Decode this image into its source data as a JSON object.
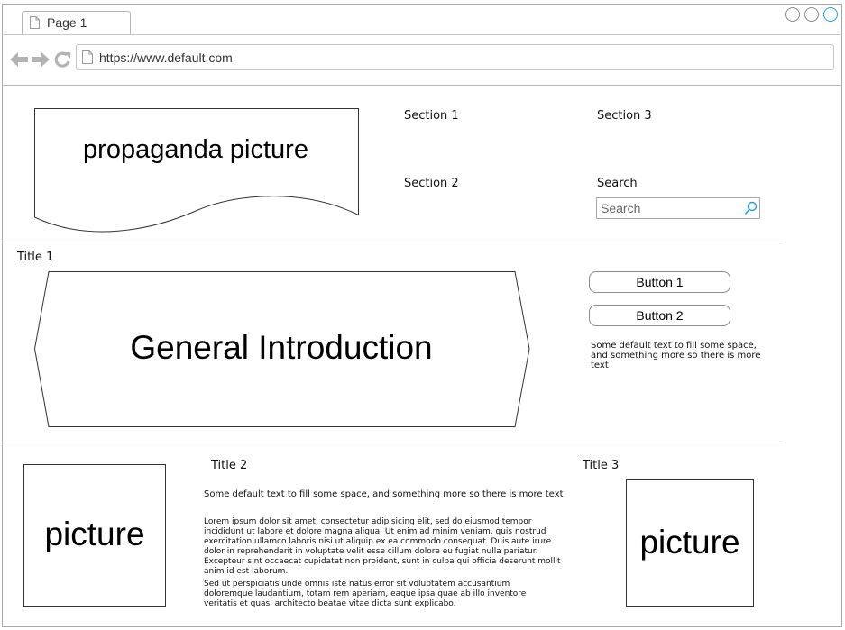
{
  "browser": {
    "tab_label": "Page 1",
    "url": "https://www.default.com"
  },
  "header": {
    "banner_text": "propaganda picture",
    "nav": {
      "section1": "Section 1",
      "section2": "Section 2",
      "section3": "Section 3"
    },
    "search_label": "Search",
    "search_placeholder": "Search"
  },
  "intro": {
    "title": "Title 1",
    "heading": "General Introduction",
    "button1": "Button 1",
    "button2": "Button 2",
    "side_text": "Some default text to fill some space, and something more so there is more text"
  },
  "bottom": {
    "left_picture": "picture",
    "title2": "Title 2",
    "intro_text": "Some default text to fill some space, and something more so there is more text",
    "paragraph1": "Lorem ipsum dolor sit amet, consectetur adipisicing elit, sed do eiusmod tempor incididunt ut labore et dolore magna aliqua. Ut enim ad minim veniam, quis nostrud exercitation ullamco laboris nisi ut aliquip ex ea commodo consequat. Duis aute irure dolor in reprehenderit in voluptate velit esse cillum dolore eu fugiat nulla pariatur. Excepteur sint occaecat cupidatat non proident, sunt in culpa qui officia deserunt mollit anim id est laborum.",
    "paragraph2": "Sed ut perspiciatis unde omnis iste natus error sit voluptatem accusantium doloremque laudantium, totam rem aperiam, eaque ipsa quae ab illo inventore veritatis et quasi architecto beatae vitae dicta sunt explicabo.",
    "title3": "Title 3",
    "right_picture": "picture"
  },
  "icons": {
    "page": "page-icon",
    "back": "back-arrow-icon",
    "forward": "forward-arrow-icon",
    "reload": "reload-icon",
    "search": "search-icon"
  },
  "colors": {
    "accent": "#1aa3e8",
    "nav_icon": "#b3b3b3",
    "border": "#a9a9a9"
  }
}
